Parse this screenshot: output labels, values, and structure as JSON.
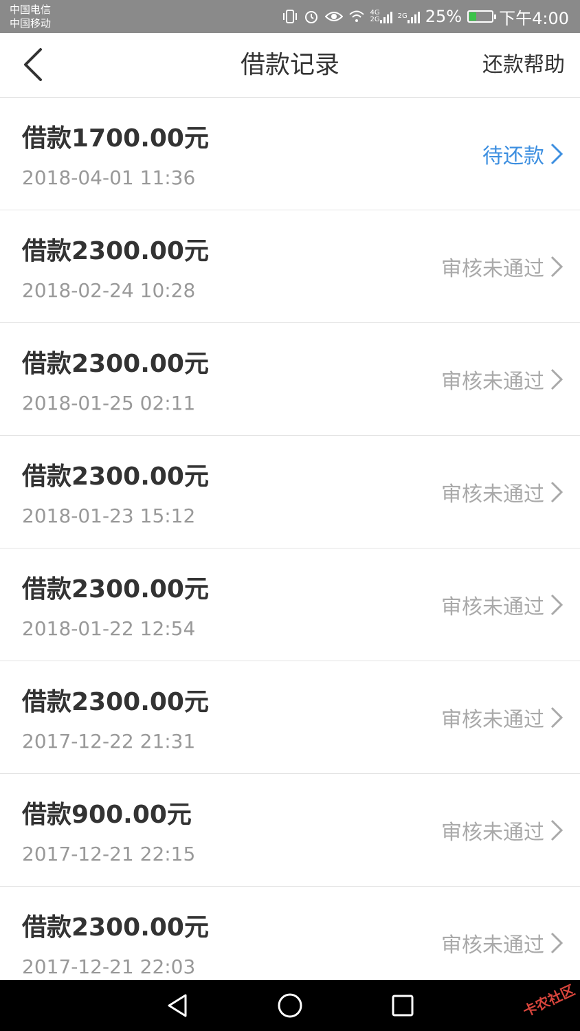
{
  "status_bar": {
    "carrier_1": "中国电信",
    "carrier_2": "中国移动",
    "net_1": "4G",
    "net_2": "2G",
    "net_3": "2G",
    "battery": "25%",
    "time": "下午4:00"
  },
  "nav": {
    "title": "借款记录",
    "help": "还款帮助"
  },
  "records": [
    {
      "amount": "借款1700.00元",
      "date": "2018-04-01 11:36",
      "status": "待还款"
    },
    {
      "amount": "借款2300.00元",
      "date": "2018-02-24 10:28",
      "status": "审核未通过"
    },
    {
      "amount": "借款2300.00元",
      "date": "2018-01-25 02:11",
      "status": "审核未通过"
    },
    {
      "amount": "借款2300.00元",
      "date": "2018-01-23 15:12",
      "status": "审核未通过"
    },
    {
      "amount": "借款2300.00元",
      "date": "2018-01-22 12:54",
      "status": "审核未通过"
    },
    {
      "amount": "借款2300.00元",
      "date": "2017-12-22 21:31",
      "status": "审核未通过"
    },
    {
      "amount": "借款900.00元",
      "date": "2017-12-21 22:15",
      "status": "审核未通过"
    },
    {
      "amount": "借款2300.00元",
      "date": "2017-12-21 22:03",
      "status": "审核未通过"
    }
  ],
  "colors": {
    "pending": "#3d8fe0",
    "rejected": "#a9a9a9",
    "status_bar": "#8a8a8a"
  },
  "watermark": "卡农社区"
}
